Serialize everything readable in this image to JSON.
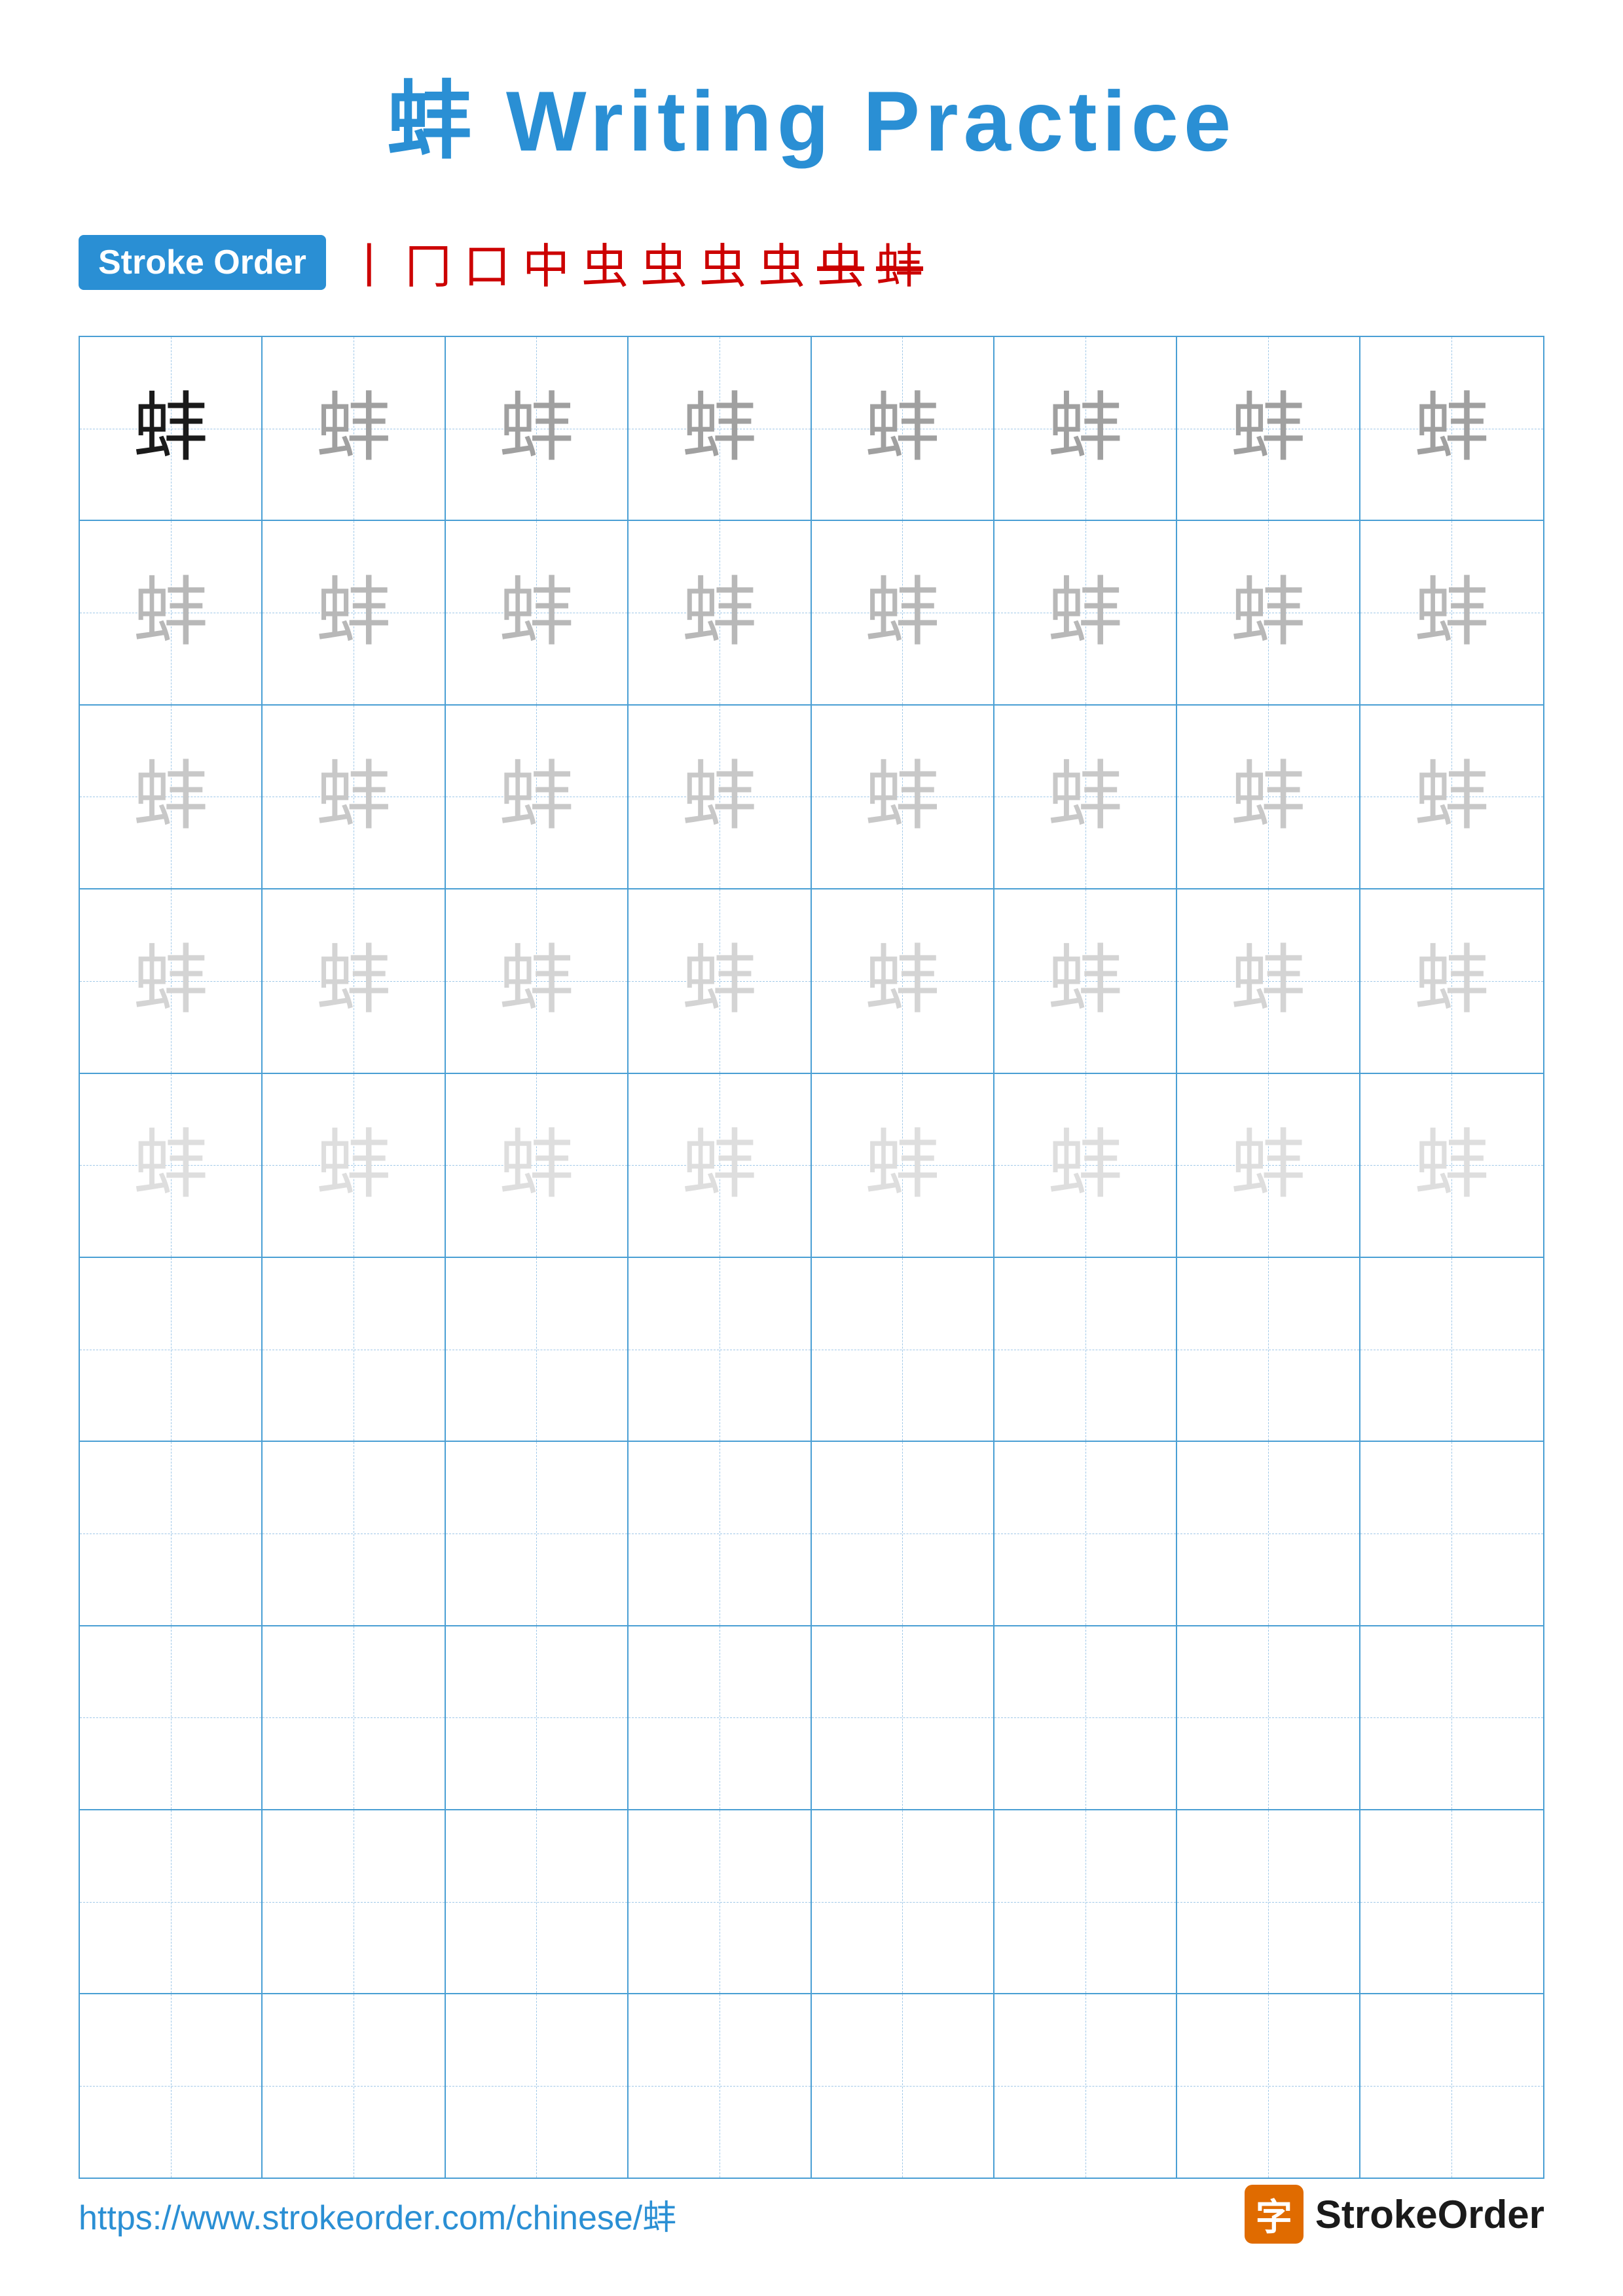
{
  "title": {
    "character": "蚌",
    "text": "蚌 Writing Practice"
  },
  "stroke_order": {
    "badge_label": "Stroke Order",
    "sequence": [
      "丨",
      "冂",
      "口",
      "中",
      "虫",
      "虫",
      "虫",
      "虫",
      "虫-",
      "蚌"
    ]
  },
  "grid": {
    "rows": 10,
    "cols": 8,
    "character": "蚌",
    "practice_rows": 5,
    "empty_rows": 5
  },
  "footer": {
    "url": "https://www.strokeorder.com/chinese/蚌",
    "logo_char": "字",
    "logo_text": "StrokeOrder"
  },
  "colors": {
    "blue": "#2a8fd4",
    "red": "#cc0000",
    "dark_char": "#1a1a1a",
    "grid_line": "#4a9fd4",
    "dashed_line": "#a0c8e8"
  }
}
